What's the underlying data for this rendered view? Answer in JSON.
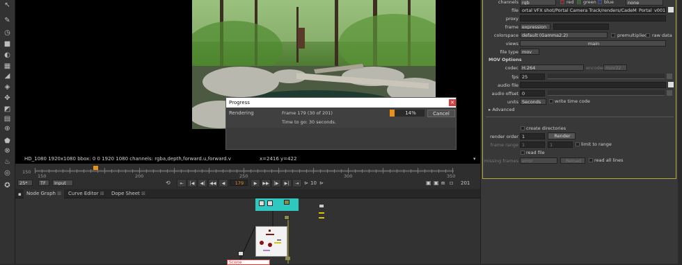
{
  "toolbar": {
    "tools": [
      {
        "icon": "pointer-icon",
        "glyph": "↖"
      },
      {
        "icon": "paint-icon",
        "glyph": "✎"
      },
      {
        "icon": "time-icon",
        "glyph": "◷"
      },
      {
        "icon": "channel-icon",
        "glyph": "■"
      },
      {
        "icon": "color-icon",
        "glyph": "◐"
      },
      {
        "icon": "filter-icon",
        "glyph": "▦"
      },
      {
        "icon": "keyer-icon",
        "glyph": "◢"
      },
      {
        "icon": "merge-icon",
        "glyph": "◈"
      },
      {
        "icon": "transform-icon",
        "glyph": "✥"
      },
      {
        "icon": "3d-icon",
        "glyph": "◩"
      },
      {
        "icon": "views-icon",
        "glyph": "▤"
      },
      {
        "icon": "metadata-icon",
        "glyph": "⊕"
      },
      {
        "icon": "toolsets-icon",
        "glyph": "⬟"
      },
      {
        "icon": "other-icon",
        "glyph": "⊗"
      },
      {
        "icon": "furnace-icon",
        "glyph": "♨"
      },
      {
        "icon": "ocula-icon",
        "glyph": "◎"
      },
      {
        "icon": "nuke-icon",
        "glyph": "✪"
      }
    ]
  },
  "viewer": {
    "info": "HD_1080 1920x1080  bbox: 0 0 1920 1080 channels: rgba,depth,forward.u,forward.v",
    "coords": "x=2416 y=422"
  },
  "progress": {
    "title": "Progress",
    "status": "Rendering",
    "frame_text": "Frame 179 (30 of 201)",
    "time_text": "Time to go: 30 seconds.",
    "percent": 14,
    "percent_label": "14%",
    "cancel": "Cancel"
  },
  "timeline": {
    "ruler_start": "150",
    "ticks": [
      "150",
      "200",
      "250",
      "300",
      "350"
    ],
    "current_frame": 179,
    "fps": "25*",
    "tf": "TF",
    "mode": "Input",
    "frame_display": "179",
    "step": "10",
    "end_frame": "201"
  },
  "panels": {
    "tabs": [
      "Node Graph",
      "Curve Editor",
      "Dope Sheet"
    ]
  },
  "graph": {
    "node_label": "Scene"
  },
  "props": {
    "channels_label": "channels",
    "channels_value": "rgb",
    "ch_red": "red",
    "ch_green": "green",
    "ch_blue": "blue",
    "ch_none": "none",
    "file_label": "file",
    "file_value": "ortal VFX shot/Portal Camera Track/renders/CadeM_Portal_v001.mov",
    "proxy_label": "proxy",
    "frame_label": "frame",
    "frame_value": "expression",
    "colorspace_label": "colorspace",
    "colorspace_value": "default (Gamma2.2)",
    "premultiplied": "premultiplied",
    "raw_data": "raw data",
    "views_label": "views",
    "views_value": "main",
    "filetype_label": "file type",
    "filetype_value": "mov",
    "mov_options": "MOV Options",
    "codec_label": "codec",
    "codec_value": "H.264",
    "encoder_label": "encoder",
    "encoder_value": "mov32",
    "fps_label": "fps",
    "fps_value": "25",
    "audiofile_label": "audio file",
    "audiooffset_label": "audio offset",
    "audiooffset_value": "0",
    "units_label": "units",
    "units_value": "Seconds",
    "write_timecode": "write time code",
    "advanced": "Advanced",
    "create_dirs": "create directories",
    "render_order_label": "render order",
    "render_order_value": "1",
    "render_btn": "Render",
    "frame_range_label": "frame range",
    "frame_range_a": "1",
    "frame_range_b": "1",
    "limit_to_range": "limit to range",
    "read_file": "read file",
    "missing_frames_label": "missing frames",
    "missing_frames_value": "error",
    "reload_btn": "Reload",
    "read_all_lines": "read all lines"
  },
  "colors": {
    "accent": "#e8901a",
    "props_border": "#b4ae3a",
    "node_teal": "#2ec8c0",
    "close_red": "#d64040"
  }
}
